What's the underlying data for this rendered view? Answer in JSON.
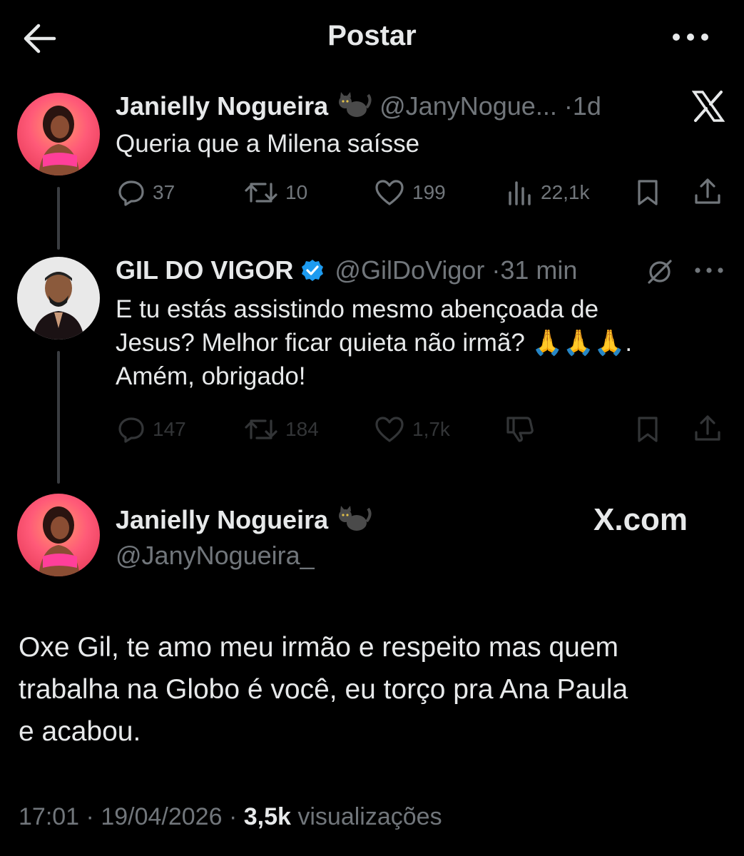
{
  "header": {
    "title": "Postar"
  },
  "tweet1": {
    "name": "Janielly Nogueira",
    "handle": "@JanyNogue...",
    "sep": "·",
    "time": "1d",
    "text": "Queria que a Milena saísse",
    "replies": "37",
    "retweets": "10",
    "likes": "199",
    "views": "22,1k"
  },
  "tweet2": {
    "name": "GIL DO VIGOR",
    "handle": "@GilDoVigor",
    "sep": "·",
    "time": "31 min",
    "text_line1": "E tu estás assistindo mesmo abençoada de",
    "text_line2": "Jesus? Melhor ficar quieta não irmã? 🙏🙏🙏.",
    "text_line3": "Amém, obrigado!",
    "replies": "147",
    "retweets": "184",
    "likes": "1,7k"
  },
  "main": {
    "name": "Janielly Nogueira",
    "handle": "@JanyNogueira_",
    "brand": "X.com",
    "text_line1": "Oxe Gil, te amo meu irmão e respeito mas quem",
    "text_line2": "trabalha na Globo é você, eu torço pra Ana Paula",
    "text_line3": "e acabou.",
    "time": "17:01",
    "date": "19/04/2026",
    "views_count": "3,5k",
    "views_label": "visualizações",
    "sep": "·"
  },
  "colors": {
    "background": "#000000",
    "text": "#e7e9ea",
    "muted": "#71767b",
    "verified": "#1d9bf0"
  },
  "icons": [
    "back-arrow-icon",
    "more-icon",
    "cat-emoji-icon",
    "x-logo-icon",
    "reply-icon",
    "retweet-icon",
    "like-icon",
    "views-icon",
    "bookmark-icon",
    "share-icon",
    "verified-badge-icon",
    "grok-icon",
    "downvote-icon",
    "praying-hands-emoji"
  ]
}
